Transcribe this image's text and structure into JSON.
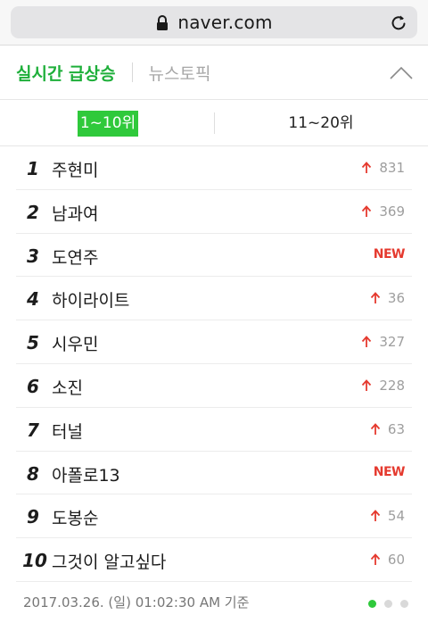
{
  "browser": {
    "host": "naver.com"
  },
  "topic_tabs": {
    "active": "실시간 급상승",
    "other": "뉴스토픽"
  },
  "range_tabs": {
    "active": "1~10위",
    "other": "11~20위"
  },
  "items": [
    {
      "rank": "1",
      "keyword": "주현미",
      "change": "831",
      "is_new": false
    },
    {
      "rank": "2",
      "keyword": "남과여",
      "change": "369",
      "is_new": false
    },
    {
      "rank": "3",
      "keyword": "도연주",
      "change": "NEW",
      "is_new": true
    },
    {
      "rank": "4",
      "keyword": "하이라이트",
      "change": "36",
      "is_new": false
    },
    {
      "rank": "5",
      "keyword": "시우민",
      "change": "327",
      "is_new": false
    },
    {
      "rank": "6",
      "keyword": "소진",
      "change": "228",
      "is_new": false
    },
    {
      "rank": "7",
      "keyword": "터널",
      "change": "63",
      "is_new": false
    },
    {
      "rank": "8",
      "keyword": "아폴로13",
      "change": "NEW",
      "is_new": true
    },
    {
      "rank": "9",
      "keyword": "도봉순",
      "change": "54",
      "is_new": false
    },
    {
      "rank": "10",
      "keyword": "그것이 알고싶다",
      "change": "60",
      "is_new": false
    }
  ],
  "footer": {
    "timestamp": "2017.03.26. (일) 01:02:30 AM 기준",
    "page_dots": 3,
    "active_dot": 1
  },
  "colors": {
    "accent_green": "#2fc93b",
    "rise_red": "#e53a2f"
  }
}
